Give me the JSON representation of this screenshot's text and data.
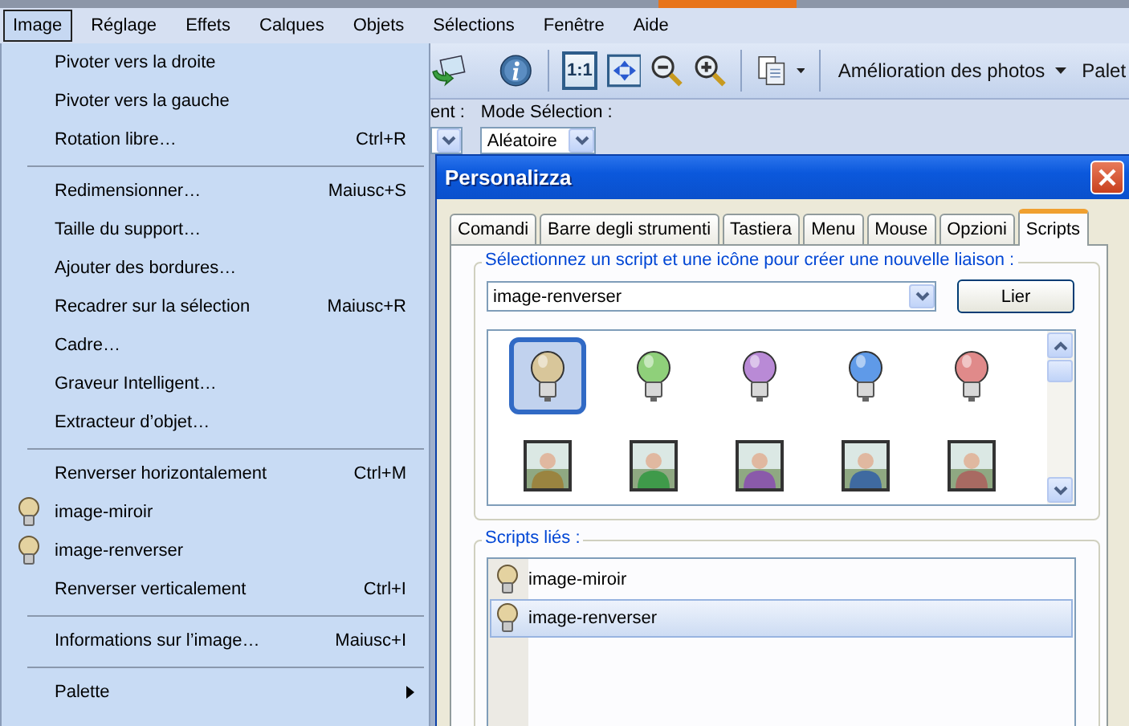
{
  "menubar": {
    "items": [
      {
        "label": "Image",
        "selected": true
      },
      {
        "label": "Réglage",
        "selected": false
      },
      {
        "label": "Effets",
        "selected": false
      },
      {
        "label": "Calques",
        "selected": false
      },
      {
        "label": "Objets",
        "selected": false
      },
      {
        "label": "Sélections",
        "selected": false
      },
      {
        "label": "Fenêtre",
        "selected": false
      },
      {
        "label": "Aide",
        "selected": false
      }
    ]
  },
  "toolbar": {
    "actual_size": "1:1",
    "enhance_menu": "Amélioration des photos",
    "palettes_menu": "Palet"
  },
  "options_bar": {
    "cut_label": "ent :",
    "mode_label": "Mode Sélection :",
    "mode_value": "Aléatoire"
  },
  "image_menu": {
    "items": [
      {
        "kind": "command",
        "label": "Pivoter vers la droite"
      },
      {
        "kind": "command",
        "label": "Pivoter vers la gauche"
      },
      {
        "kind": "command",
        "label": "Rotation libre…",
        "shortcut": "Ctrl+R"
      },
      {
        "kind": "separator"
      },
      {
        "kind": "command",
        "label": "Redimensionner…",
        "shortcut": "Maiusc+S"
      },
      {
        "kind": "command",
        "label": "Taille du support…"
      },
      {
        "kind": "command",
        "label": "Ajouter des bordures…"
      },
      {
        "kind": "command",
        "label": "Recadrer sur la sélection",
        "shortcut": "Maiusc+R"
      },
      {
        "kind": "command",
        "label": "Cadre…"
      },
      {
        "kind": "command",
        "label": "Graveur Intelligent…"
      },
      {
        "kind": "command",
        "label": "Extracteur d’objet…"
      },
      {
        "kind": "separator"
      },
      {
        "kind": "command",
        "label": "Renverser horizontalement",
        "shortcut": "Ctrl+M"
      },
      {
        "kind": "script",
        "label": "image-miroir"
      },
      {
        "kind": "script",
        "label": "image-renverser"
      },
      {
        "kind": "command",
        "label": "Renverser verticalement",
        "shortcut": "Ctrl+I"
      },
      {
        "kind": "separator"
      },
      {
        "kind": "command",
        "label": "Informations sur l’image…",
        "shortcut": "Maiusc+I"
      },
      {
        "kind": "separator"
      },
      {
        "kind": "submenu",
        "label": "Palette"
      }
    ]
  },
  "dialog": {
    "title": "Personalizza",
    "tabs": [
      {
        "label": "Comandi",
        "selected": false
      },
      {
        "label": "Barre degli strumenti",
        "selected": false
      },
      {
        "label": "Tastiera",
        "selected": false
      },
      {
        "label": "Menu",
        "selected": false
      },
      {
        "label": "Mouse",
        "selected": false
      },
      {
        "label": "Opzioni",
        "selected": false
      },
      {
        "label": "Scripts",
        "selected": true
      }
    ],
    "new_binding": {
      "legend": "Sélectionnez un script et une icône pour créer une nouvelle liaison :",
      "script": "image-renverser",
      "button": "Lier",
      "icons": [
        {
          "kind": "bulb",
          "color": "#d8c69a",
          "selected": true
        },
        {
          "kind": "bulb",
          "color": "#8fd07a",
          "selected": false
        },
        {
          "kind": "bulb",
          "color": "#b98ad6",
          "selected": false
        },
        {
          "kind": "bulb",
          "color": "#5f9ae8",
          "selected": false
        },
        {
          "kind": "bulb",
          "color": "#e08a8a",
          "selected": false
        },
        {
          "kind": "person",
          "color": "#9a8440",
          "selected": false
        },
        {
          "kind": "person",
          "color": "#3f9a4a",
          "selected": false
        },
        {
          "kind": "person",
          "color": "#8a5aaa",
          "selected": false
        },
        {
          "kind": "person",
          "color": "#3f6aa0",
          "selected": false
        },
        {
          "kind": "person",
          "color": "#a86a62",
          "selected": false
        }
      ]
    },
    "bound_scripts": {
      "legend": "Scripts liés :",
      "items": [
        {
          "label": "image-miroir",
          "selected": false
        },
        {
          "label": "image-renverser",
          "selected": true
        }
      ]
    }
  }
}
